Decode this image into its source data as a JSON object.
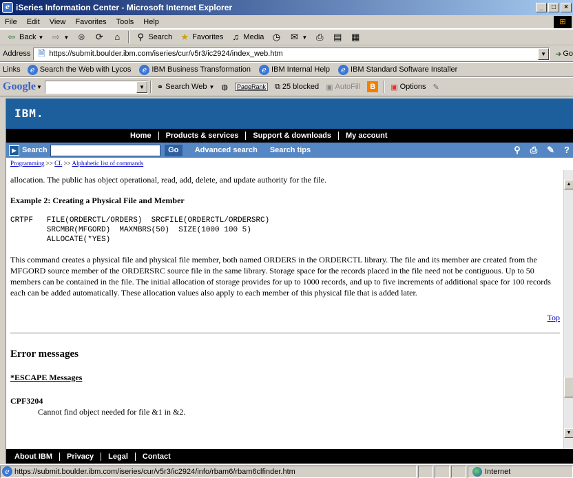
{
  "window": {
    "title": "iSeries Information Center - Microsoft Internet Explorer"
  },
  "menu": [
    "File",
    "Edit",
    "View",
    "Favorites",
    "Tools",
    "Help"
  ],
  "toolbar": {
    "back": "Back",
    "search": "Search",
    "favorites": "Favorites",
    "media": "Media"
  },
  "address": {
    "label": "Address",
    "url": "https://submit.boulder.ibm.com/iseries/cur/v5r3/ic2924/index_web.htm",
    "go": "Go"
  },
  "links": {
    "label": "Links",
    "items": [
      "Search the Web with Lycos",
      "IBM Business Transformation",
      "IBM Internal Help",
      "IBM Standard Software Installer"
    ]
  },
  "google": {
    "logo": "Google",
    "search_web": "Search Web",
    "pagerank": "PageRank",
    "blocked": "25 blocked",
    "autofill": "AutoFill",
    "options": "Options"
  },
  "ibm": {
    "logo": "IBM.",
    "nav": [
      "Home",
      "Products & services",
      "Support & downloads",
      "My account"
    ],
    "search_label": "Search",
    "go": "Go",
    "advanced_search": "Advanced search",
    "search_tips": "Search tips",
    "footer": [
      "About IBM",
      "Privacy",
      "Legal",
      "Contact"
    ]
  },
  "breadcrumb": {
    "items": [
      "Programming",
      "CL",
      "Alphabetic list of commands"
    ],
    "sep": ">>"
  },
  "doc": {
    "cut_text": "allocation. The public has object operational, read, add, delete, and update authority for the file.",
    "example_heading": "Example 2: Creating a Physical File and Member",
    "code_line1": "CRTPF   FILE(ORDERCTL/ORDERS)  SRCFILE(ORDERCTL/ORDERSRC)",
    "code_line2": "        SRCMBR(MFGORD)  MAXMBRS(50)  SIZE(1000 100 5)",
    "code_line3": "        ALLOCATE(*YES)",
    "body": "This command creates a physical file and physical file member, both named ORDERS in the ORDERCTL library. The file and its member are created from the MFGORD source member of the ORDERSRC source file in the same library. Storage space for the records placed in the file need not be contiguous. Up to 50 members can be contained in the file. The initial allocation of storage provides for up to 1000 records, and up to five increments of additional space for 100 records each can be added automatically. These allocation values also apply to each member of this physical file that is added later.",
    "top_link": "Top",
    "error_heading": "Error messages",
    "escape_heading": "*ESCAPE Messages",
    "cpf_id": "CPF3204",
    "cpf_msg": "Cannot find object needed for file &1 in &2."
  },
  "status": {
    "url": "https://submit.boulder.ibm.com/iseries/cur/v5r3/ic2924/info/rbam6/rbam6clfinder.htm",
    "zone": "Internet"
  }
}
